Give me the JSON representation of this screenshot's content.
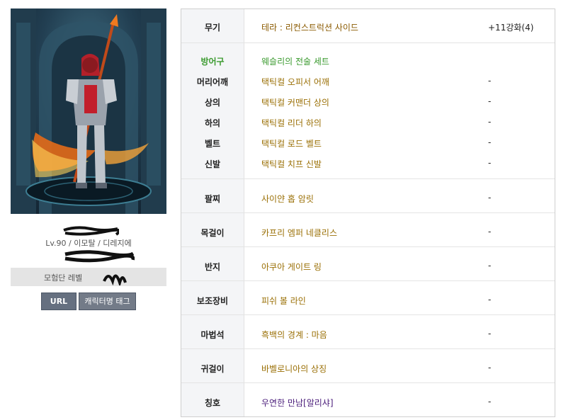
{
  "profile": {
    "level_text": "Lv.90 / 이모탈 / 디레지에",
    "adventure_label": "모험단 레벨",
    "url_button": "URL",
    "tag_button": "캐릭터명 태그"
  },
  "equipment": {
    "weapon": {
      "label": "무기",
      "item": "테라 : 리컨스트럭션 사이드",
      "enhance": "+11강화(4)"
    },
    "armor": {
      "label": "방어구",
      "item": "웨슬리의 전술 세트"
    },
    "shoulder": {
      "label": "머리어깨",
      "item": "택틱컬 오피서 어깨",
      "enhance": "-"
    },
    "top": {
      "label": "상의",
      "item": "택틱컬 커맨더 상의",
      "enhance": "-"
    },
    "bottom": {
      "label": "하의",
      "item": "택틱컬 리더 하의",
      "enhance": "-"
    },
    "belt": {
      "label": "벨트",
      "item": "택틱컬 로드 벨트",
      "enhance": "-"
    },
    "shoes": {
      "label": "신발",
      "item": "택틱컬 치프 신발",
      "enhance": "-"
    },
    "bracelet": {
      "label": "팔찌",
      "item": "사이얀 홉 암릿",
      "enhance": "-"
    },
    "necklace": {
      "label": "목걸이",
      "item": "카프리 엠퍼 네클리스",
      "enhance": "-"
    },
    "ring": {
      "label": "반지",
      "item": "아쿠아 게이트 링",
      "enhance": "-"
    },
    "support": {
      "label": "보조장비",
      "item": "피쉬 볼 라인",
      "enhance": "-"
    },
    "magic": {
      "label": "마법석",
      "item": "흑백의 경계 : 마음",
      "enhance": "-"
    },
    "earring": {
      "label": "귀걸이",
      "item": "바벨로니아의 상징",
      "enhance": "-"
    },
    "title": {
      "label": "칭호",
      "item": "우연한 만남[알리샤]",
      "enhance": "-"
    }
  },
  "colors": {
    "set_item": "#3a9a2e",
    "epic_item": "#9a6f05",
    "title_item": "#4a1c7a",
    "label_bg": "#f4f5f7"
  }
}
